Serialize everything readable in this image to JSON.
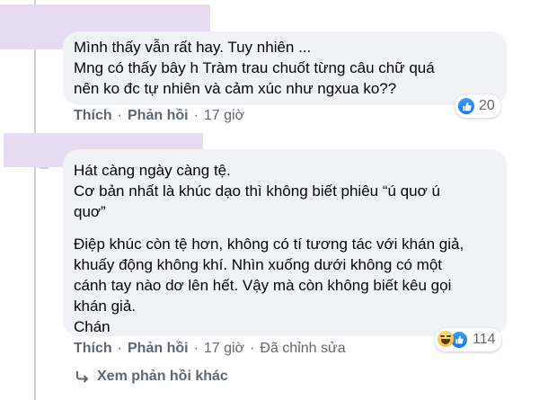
{
  "comment1": {
    "lines": [
      "Mình thấy vẫn rất hay. Tuy nhiên ...",
      "Mng có thấy bây h Tràm trau chuốt từng câu chữ quá",
      "nên ko đc tự nhiên và cảm xúc như ngxua ko??"
    ],
    "reaction_count": "20",
    "like_label": "Thích",
    "reply_label": "Phản hồi",
    "time": "17 giờ"
  },
  "comment2": {
    "para1": [
      "Hát càng ngày càng tệ.",
      "Cơ bản nhất là khúc dạo thì không biết phiêu “ú quơ ú",
      "quơ”"
    ],
    "para2": [
      "Điệp khúc còn tệ hơn, không có tí tương tác với khán giả,",
      "khuấy động không khí. Nhìn xuống dưới không có một",
      "cánh tay nào dơ lên hết. Vậy mà còn không biết kêu gọi",
      "khán giả.",
      "Chán"
    ],
    "reaction_count": "114",
    "like_label": "Thích",
    "reply_label": "Phản hồi",
    "time": "17 giờ",
    "edited": "Đã chỉnh sửa"
  },
  "more_replies": "Xem phản hồi khác",
  "icons": {
    "reaction1": [
      "like-icon"
    ],
    "reaction2": [
      "haha-icon",
      "like-icon"
    ],
    "more": "reply-arrow-icon"
  },
  "colors": {
    "bubble": "#f0f2f5",
    "action_text": "#606770",
    "like_blue": "#1877f2",
    "redaction": "#e7dbf2"
  }
}
